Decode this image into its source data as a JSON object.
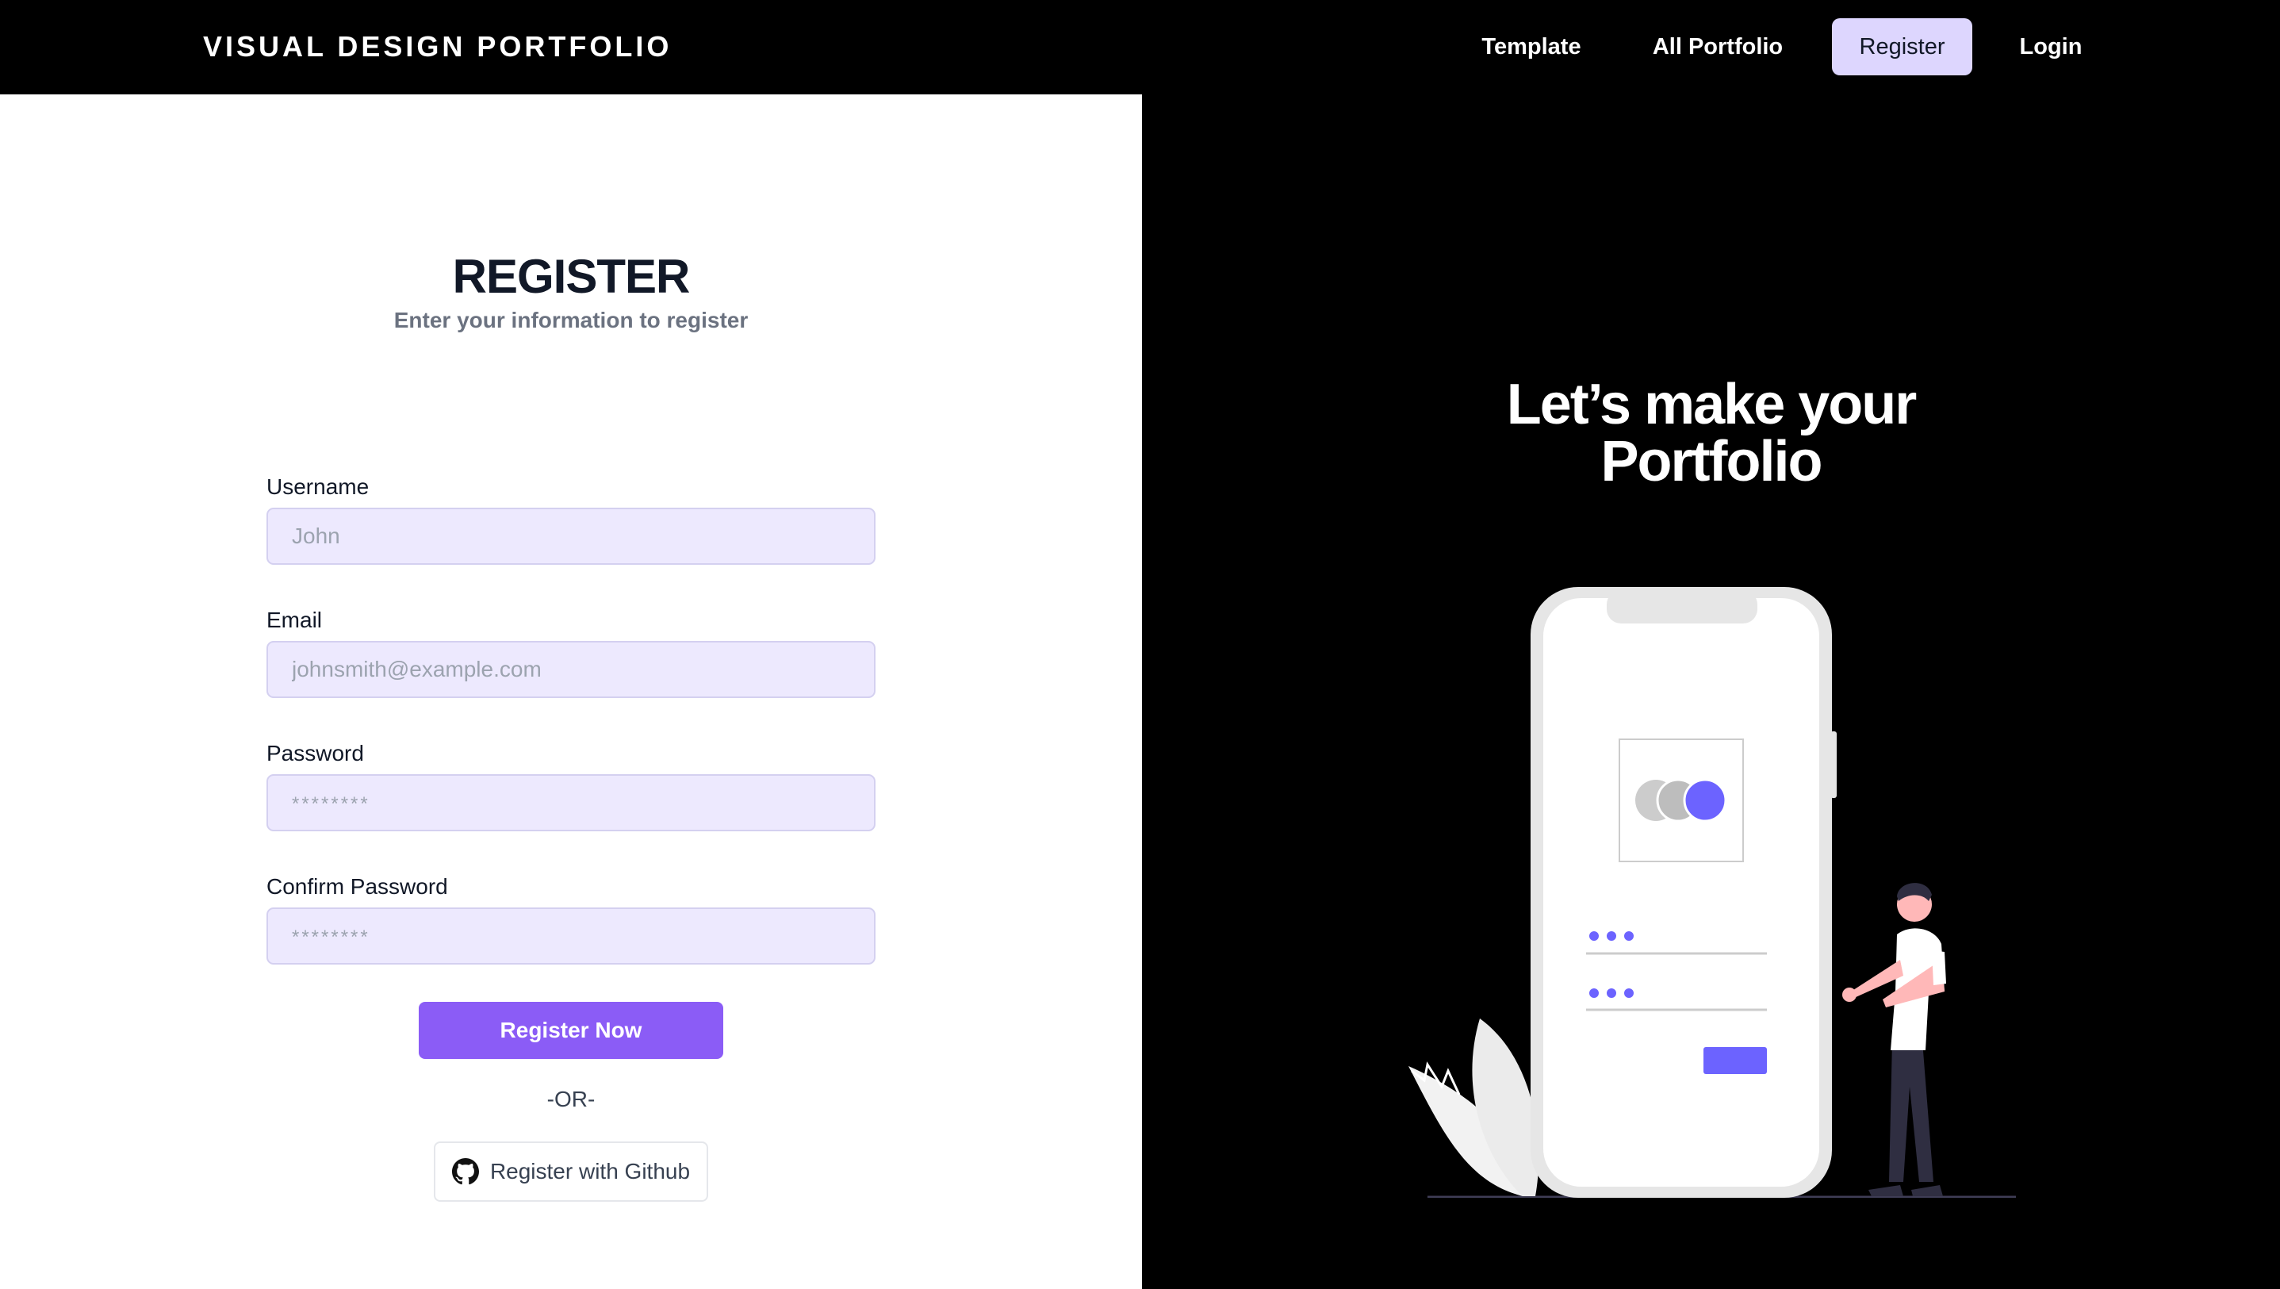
{
  "navbar": {
    "brand": "VISUAL DESIGN PORTFOLIO",
    "links": [
      {
        "label": "Template"
      },
      {
        "label": "All Portfolio"
      },
      {
        "label": "Register",
        "active": true
      },
      {
        "label": "Login"
      }
    ]
  },
  "form": {
    "title": "REGISTER",
    "subtitle": "Enter your information to register",
    "fields": [
      {
        "label": "Username",
        "placeholder": "John",
        "type": "text"
      },
      {
        "label": "Email",
        "placeholder": "johnsmith@example.com",
        "type": "email"
      },
      {
        "label": "Password",
        "placeholder": "********",
        "type": "password"
      },
      {
        "label": "Confirm Password",
        "placeholder": "********",
        "type": "password"
      }
    ],
    "submit_label": "Register Now",
    "or_text": "-OR-",
    "github_label": "Register with Github",
    "github_icon": "github-icon"
  },
  "hero": {
    "title_line1": "Let’s make your",
    "title_line2": "Portfolio"
  },
  "colors": {
    "accent": "#8b5cf6",
    "illustration_accent": "#6c63ff",
    "input_bg": "#ede9fe",
    "active_nav_bg": "#ddd6fe"
  }
}
